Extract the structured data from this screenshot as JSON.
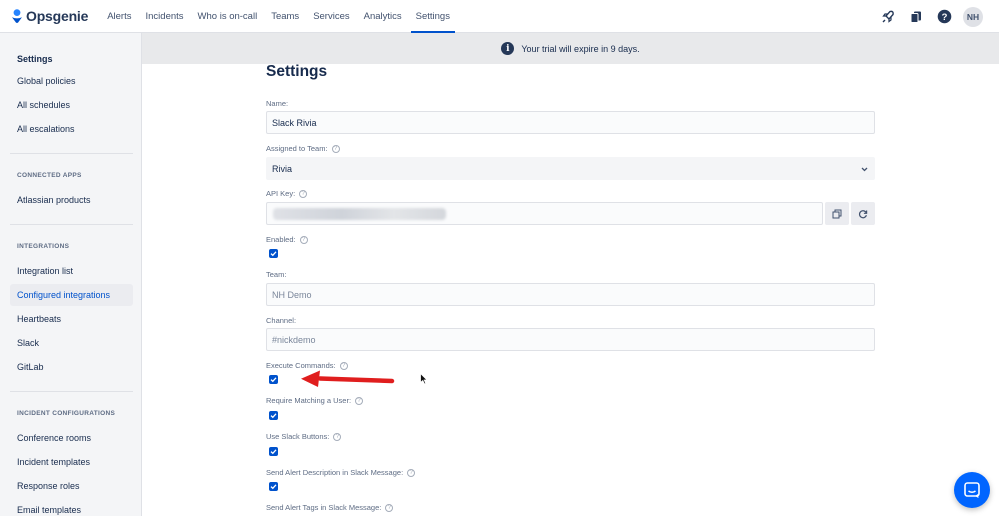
{
  "brand": {
    "name": "Opsgenie"
  },
  "nav": {
    "links": [
      {
        "label": "Alerts"
      },
      {
        "label": "Incidents"
      },
      {
        "label": "Who is on-call"
      },
      {
        "label": "Teams"
      },
      {
        "label": "Services"
      },
      {
        "label": "Analytics"
      },
      {
        "label": "Settings",
        "active": true
      }
    ],
    "icons": [
      "rocket-icon",
      "apps-icon",
      "help-icon"
    ],
    "avatar_initials": "NH"
  },
  "sidebar": {
    "top_items": [
      {
        "label": "Settings",
        "bold": true
      },
      {
        "label": "Global policies"
      },
      {
        "label": "All schedules"
      },
      {
        "label": "All escalations"
      }
    ],
    "connected_apps": {
      "heading": "CONNECTED APPS",
      "items": [
        {
          "label": "Atlassian products"
        }
      ]
    },
    "integrations": {
      "heading": "INTEGRATIONS",
      "items": [
        {
          "label": "Integration list"
        },
        {
          "label": "Configured integrations",
          "active": true
        },
        {
          "label": "Heartbeats"
        },
        {
          "label": "Slack"
        },
        {
          "label": "GitLab"
        }
      ]
    },
    "incident_configurations": {
      "heading": "INCIDENT CONFIGURATIONS",
      "items": [
        {
          "label": "Conference rooms"
        },
        {
          "label": "Incident templates"
        },
        {
          "label": "Response roles"
        },
        {
          "label": "Email templates"
        }
      ]
    }
  },
  "banner": {
    "text": "Your trial will expire in 9 days."
  },
  "form": {
    "title": "Settings",
    "name_label": "Name:",
    "name_value": "Slack Rivia",
    "team_assigned_label": "Assigned to Team:",
    "team_assigned_value": "Rivia",
    "api_key_label": "API Key:",
    "enabled_label": "Enabled:",
    "enabled_checked": true,
    "team_label": "Team:",
    "team_placeholder": "NH Demo",
    "channel_label": "Channel:",
    "channel_placeholder": "#nickdemo",
    "execute_commands_label": "Execute Commands:",
    "execute_commands_checked": true,
    "require_matching_user_label": "Require Matching a User:",
    "require_matching_user_checked": true,
    "use_slack_buttons_label": "Use Slack Buttons:",
    "use_slack_buttons_checked": true,
    "send_alert_description_label": "Send Alert Description in Slack Message:",
    "send_alert_description_checked": true,
    "send_alert_tags_label": "Send Alert Tags in Slack Message:"
  },
  "colors": {
    "accent": "#0052cc",
    "annotation_arrow": "#e01e1e",
    "chat_button": "#0065ff"
  }
}
